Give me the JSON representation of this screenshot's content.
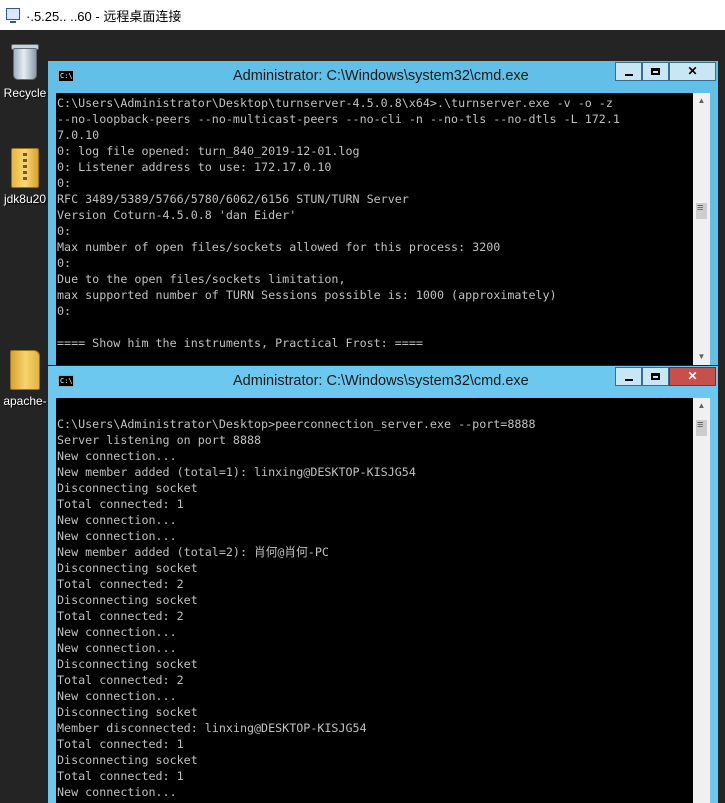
{
  "rdp": {
    "title": "·.5.25.. ..60 - 远程桌面连接",
    "icon": "remote-desktop-icon"
  },
  "desktop": {
    "icons": [
      {
        "label": "Recycle",
        "icon": "recycle-bin-icon"
      },
      {
        "label": "jdk8u20",
        "icon": "zip-file-icon"
      },
      {
        "label": "apache-",
        "icon": "folder-icon"
      }
    ]
  },
  "windows": [
    {
      "title": "Administrator: C:\\Windows\\system32\\cmd.exe",
      "icon_text": "C:\\",
      "lines": [
        "C:\\Users\\Administrator\\Desktop\\turnserver-4.5.0.8\\x64>.\\turnserver.exe -v -o -z",
        "--no-loopback-peers --no-multicast-peers --no-cli -n --no-tls --no-dtls -L 172.1",
        "7.0.10",
        "0: log file opened: turn_840_2019-12-01.log",
        "0: Listener address to use: 172.17.0.10",
        "0:",
        "RFC 3489/5389/5766/5780/6062/6156 STUN/TURN Server",
        "Version Coturn-4.5.0.8 'dan Eider'",
        "0:",
        "Max number of open files/sockets allowed for this process: 3200",
        "0:",
        "Due to the open files/sockets limitation,",
        "max supported number of TURN Sessions possible is: 1000 (approximately)",
        "0:",
        "",
        "==== Show him the instruments, Practical Frost: ===="
      ]
    },
    {
      "title": "Administrator: C:\\Windows\\system32\\cmd.exe",
      "icon_text": "C:\\",
      "lines": [
        "",
        "C:\\Users\\Administrator\\Desktop>peerconnection_server.exe --port=8888",
        "Server listening on port 8888",
        "New connection...",
        "New member added (total=1): linxing@DESKTOP-KISJG54",
        "Disconnecting socket",
        "Total connected: 1",
        "New connection...",
        "New connection...",
        "New member added (total=2): 肖何@肖何-PC",
        "Disconnecting socket",
        "Total connected: 2",
        "Disconnecting socket",
        "Total connected: 2",
        "New connection...",
        "New connection...",
        "Disconnecting socket",
        "Total connected: 2",
        "New connection...",
        "Disconnecting socket",
        "Member disconnected: linxing@DESKTOP-KISJG54",
        "Total connected: 1",
        "Disconnecting socket",
        "Total connected: 1",
        "New connection..."
      ]
    }
  ],
  "controls": {
    "minimize": "minimize-icon",
    "maximize": "maximize-icon",
    "close": "✕"
  }
}
